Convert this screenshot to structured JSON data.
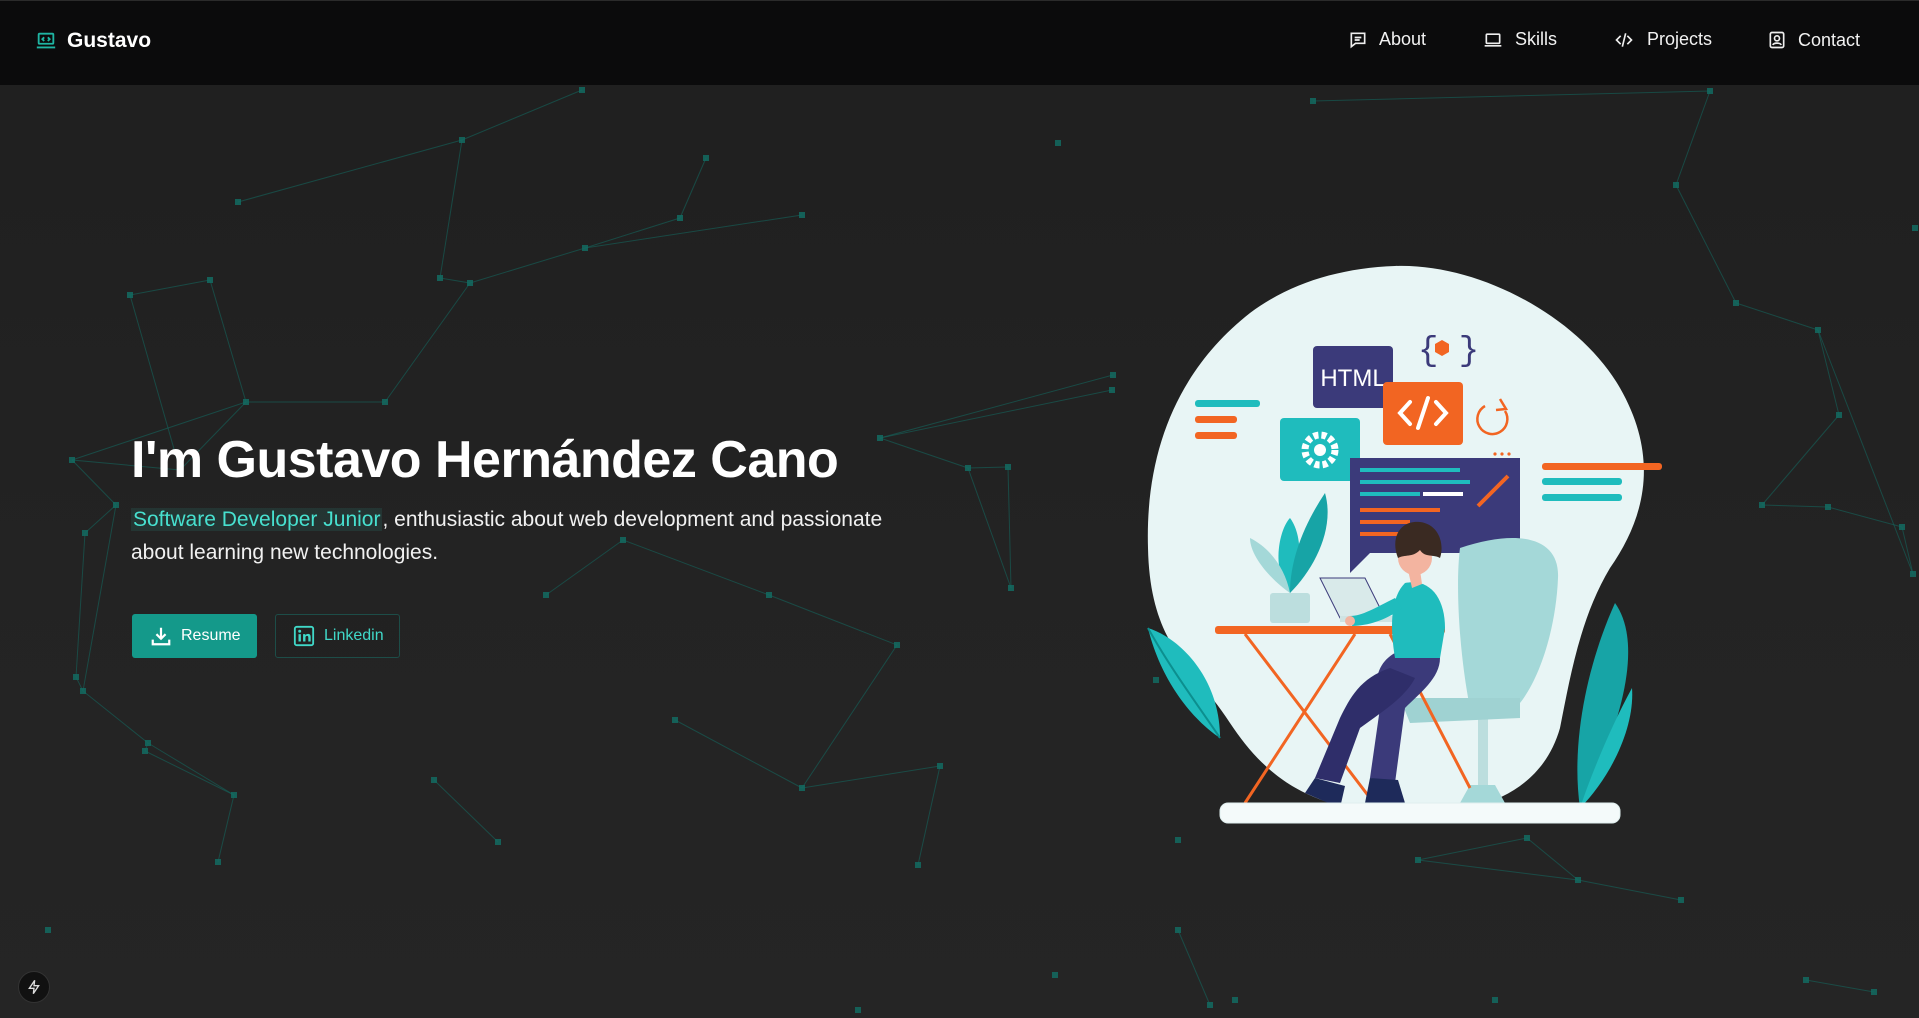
{
  "brand": {
    "name": "Gustavo",
    "icon": "laptop-code-icon"
  },
  "nav": [
    {
      "label": "About",
      "icon": "message-icon"
    },
    {
      "label": "Skills",
      "icon": "laptop-icon"
    },
    {
      "label": "Projects",
      "icon": "code-icon"
    },
    {
      "label": "Contact",
      "icon": "contact-card-icon"
    }
  ],
  "hero": {
    "title": "I'm Gustavo Hernández Cano",
    "highlight": "Software Developer Junior",
    "description": ", enthusiastic about web development and passionate about learning new technologies."
  },
  "buttons": {
    "resume": "Resume",
    "linkedin": "Linkedin"
  },
  "illustration": {
    "html_label": "HTML"
  },
  "colors": {
    "accent": "#14998a",
    "accent_light": "#47e0cf",
    "network": "#136b62",
    "orange": "#f26522",
    "navy": "#3b3a7a"
  }
}
